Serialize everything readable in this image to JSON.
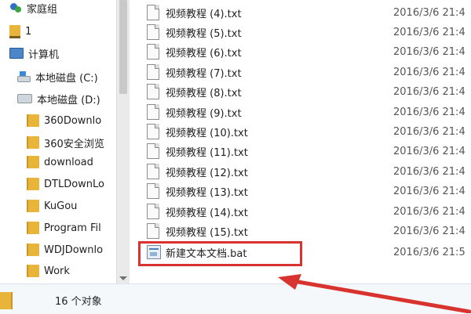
{
  "nav": {
    "items": [
      {
        "label": "家庭组",
        "icon": "homegroup-icon"
      },
      {
        "label": "1",
        "icon": "library-icon"
      },
      {
        "label": "计算机",
        "icon": "computer-icon"
      },
      {
        "label": "本地磁盘 (C:)",
        "icon": "drive-c-icon"
      },
      {
        "label": "本地磁盘 (D:)",
        "icon": "drive-d-icon"
      },
      {
        "label": "360Downlo",
        "icon": "folder-icon"
      },
      {
        "label": "360安全浏览",
        "icon": "folder-icon"
      },
      {
        "label": "download",
        "icon": "folder-icon"
      },
      {
        "label": "DTLDownLo",
        "icon": "folder-icon"
      },
      {
        "label": "KuGou",
        "icon": "folder-icon"
      },
      {
        "label": "Program Fil",
        "icon": "folder-icon"
      },
      {
        "label": "WDJDownlo",
        "icon": "folder-icon"
      },
      {
        "label": "Work",
        "icon": "folder-icon"
      }
    ]
  },
  "files": [
    {
      "name": "视频教程 (4).txt",
      "date": "2016/3/6 21:4"
    },
    {
      "name": "视频教程 (5).txt",
      "date": "2016/3/6 21:4"
    },
    {
      "name": "视频教程 (6).txt",
      "date": "2016/3/6 21:4"
    },
    {
      "name": "视频教程 (7).txt",
      "date": "2016/3/6 21:4"
    },
    {
      "name": "视频教程 (8).txt",
      "date": "2016/3/6 21:4"
    },
    {
      "name": "视频教程 (9).txt",
      "date": "2016/3/6 21:4"
    },
    {
      "name": "视频教程 (10).txt",
      "date": "2016/3/6 21:4"
    },
    {
      "name": "视频教程 (11).txt",
      "date": "2016/3/6 21:4"
    },
    {
      "name": "视频教程 (12).txt",
      "date": "2016/3/6 21:4"
    },
    {
      "name": "视频教程 (13).txt",
      "date": "2016/3/6 21:4"
    },
    {
      "name": "视频教程 (14).txt",
      "date": "2016/3/6 21:4"
    },
    {
      "name": "视频教程 (15).txt",
      "date": "2016/3/6 21:4"
    }
  ],
  "bat_file": {
    "name": "新建文本文档.bat",
    "date": "2016/3/6 21:5"
  },
  "status": {
    "text": "16 个对象"
  },
  "colors": {
    "highlight": "#d8332f",
    "folder": "#e8b43a"
  }
}
